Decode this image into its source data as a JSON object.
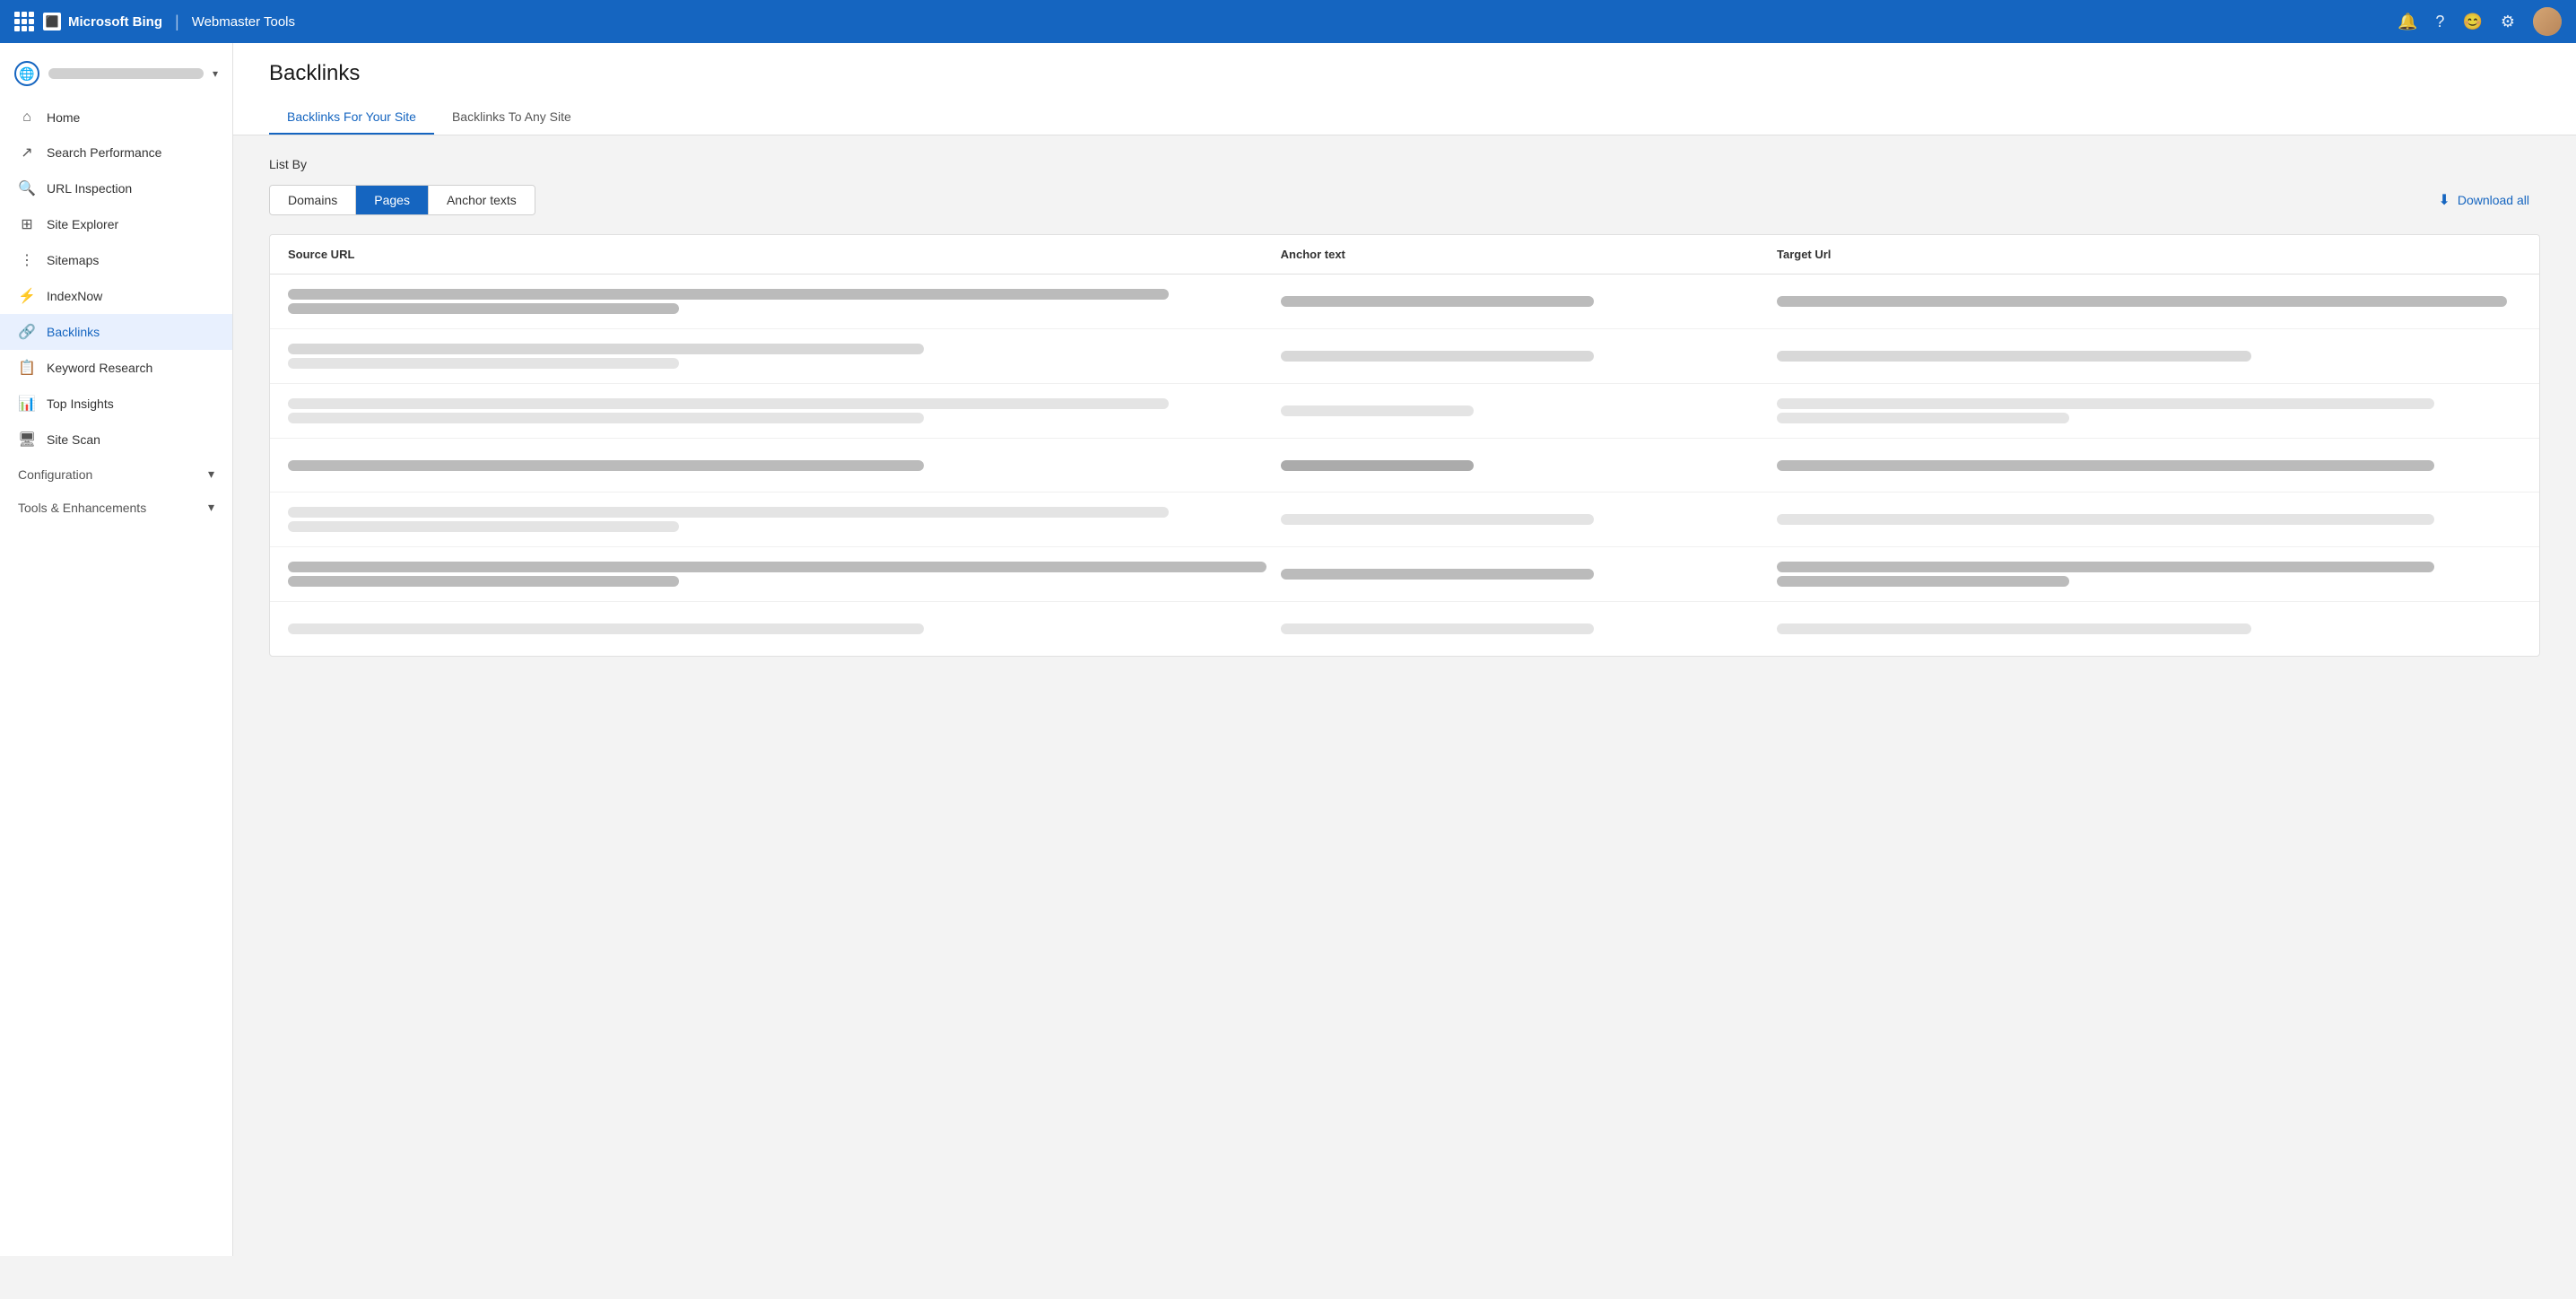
{
  "app": {
    "brand": "Microsoft Bing",
    "separator": "|",
    "product": "Webmaster Tools"
  },
  "topNav": {
    "notification_label": "Notifications",
    "help_label": "Help",
    "feedback_label": "Feedback",
    "settings_label": "Settings",
    "profile_label": "User Profile"
  },
  "sidebar": {
    "site_placeholder": "Site URL",
    "nav_items": [
      {
        "id": "home",
        "label": "Home",
        "icon": "home"
      },
      {
        "id": "search-performance",
        "label": "Search Performance",
        "icon": "trending-up"
      },
      {
        "id": "url-inspection",
        "label": "URL Inspection",
        "icon": "search"
      },
      {
        "id": "site-explorer",
        "label": "Site Explorer",
        "icon": "grid"
      },
      {
        "id": "sitemaps",
        "label": "Sitemaps",
        "icon": "sitemap"
      },
      {
        "id": "indexnow",
        "label": "IndexNow",
        "icon": "flash"
      },
      {
        "id": "backlinks",
        "label": "Backlinks",
        "icon": "link",
        "active": true
      },
      {
        "id": "keyword-research",
        "label": "Keyword Research",
        "icon": "research"
      },
      {
        "id": "top-insights",
        "label": "Top Insights",
        "icon": "insights"
      },
      {
        "id": "site-scan",
        "label": "Site Scan",
        "icon": "scan"
      }
    ],
    "sections": [
      {
        "id": "configuration",
        "label": "Configuration"
      },
      {
        "id": "tools-enhancements",
        "label": "Tools & Enhancements"
      }
    ]
  },
  "page": {
    "title": "Backlinks",
    "tabs": [
      {
        "id": "for-your-site",
        "label": "Backlinks For Your Site",
        "active": true
      },
      {
        "id": "to-any-site",
        "label": "Backlinks To Any Site",
        "active": false
      }
    ],
    "list_by_label": "List By",
    "filter_buttons": [
      {
        "id": "domains",
        "label": "Domains",
        "active": false
      },
      {
        "id": "pages",
        "label": "Pages",
        "active": true
      },
      {
        "id": "anchor-texts",
        "label": "Anchor texts",
        "active": false
      }
    ],
    "download_button": "Download all",
    "table": {
      "headers": [
        {
          "id": "source-url",
          "label": "Source URL"
        },
        {
          "id": "anchor-text",
          "label": "Anchor text"
        },
        {
          "id": "target-url",
          "label": "Target Url"
        }
      ],
      "rows": [
        {
          "id": 1,
          "source_bars": [
            "long",
            "short"
          ],
          "anchor_bars": [
            "medium"
          ],
          "target_bars": [
            "full"
          ]
        },
        {
          "id": 2,
          "source_bars": [
            "medium",
            "short"
          ],
          "anchor_bars": [
            "medium"
          ],
          "target_bars": [
            "medium"
          ]
        },
        {
          "id": 3,
          "source_bars": [
            "long",
            "medium"
          ],
          "anchor_bars": [
            "short"
          ],
          "target_bars": [
            "long",
            "short"
          ]
        },
        {
          "id": 4,
          "source_bars": [
            "medium"
          ],
          "anchor_bars": [
            "short"
          ],
          "target_bars": [
            "long"
          ]
        },
        {
          "id": 5,
          "source_bars": [
            "long",
            "short"
          ],
          "anchor_bars": [
            "medium"
          ],
          "target_bars": [
            "long"
          ]
        },
        {
          "id": 6,
          "source_bars": [
            "full",
            "short"
          ],
          "anchor_bars": [
            "medium"
          ],
          "target_bars": [
            "long",
            "short"
          ]
        },
        {
          "id": 7,
          "source_bars": [
            "medium"
          ],
          "anchor_bars": [
            "medium"
          ],
          "target_bars": [
            "medium"
          ]
        }
      ]
    }
  },
  "colors": {
    "primary": "#1565c0",
    "active_tab_border": "#1565c0",
    "active_filter_bg": "#1565c0",
    "sidebar_active_bg": "#e8f0fe",
    "top_nav_bg": "#1565c0"
  }
}
